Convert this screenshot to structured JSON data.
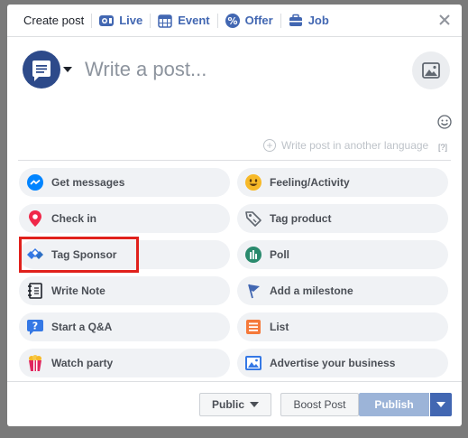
{
  "tabs": [
    {
      "label": "Create post",
      "icon": "pencil-icon"
    },
    {
      "label": "Live",
      "icon": "live-video-icon"
    },
    {
      "label": "Event",
      "icon": "calendar-icon"
    },
    {
      "label": "Offer",
      "icon": "percent-badge-icon"
    },
    {
      "label": "Job",
      "icon": "briefcase-icon"
    }
  ],
  "composer": {
    "placeholder": "Write a post...",
    "translate_label": "Write post in another language",
    "help_label": "[?]"
  },
  "options": [
    {
      "label": "Get messages",
      "icon": "messenger-icon",
      "color": "#0084ff"
    },
    {
      "label": "Feeling/Activity",
      "icon": "smiley-icon",
      "color": "#f7b928"
    },
    {
      "label": "Check in",
      "icon": "location-pin-icon",
      "color": "#f02849"
    },
    {
      "label": "Tag product",
      "icon": "tag-icon",
      "color": "#606770"
    },
    {
      "label": "Tag Sponsor",
      "icon": "handshake-icon",
      "color": "#3578e5"
    },
    {
      "label": "Poll",
      "icon": "poll-icon",
      "color": "#2a8a6d"
    },
    {
      "label": "Write Note",
      "icon": "notebook-icon",
      "color": "#1d2129"
    },
    {
      "label": "Add a milestone",
      "icon": "flag-icon",
      "color": "#4267b2"
    },
    {
      "label": "Start a Q&A",
      "icon": "question-bubble-icon",
      "color": "#3578e5"
    },
    {
      "label": "List",
      "icon": "list-icon",
      "color": "#f5793a"
    },
    {
      "label": "Watch party",
      "icon": "popcorn-icon",
      "color": "#e0245e"
    },
    {
      "label": "Advertise your business",
      "icon": "image-ad-icon",
      "color": "#3578e5"
    }
  ],
  "footer": {
    "audience_label": "Public",
    "boost_label": "Boost Post",
    "publish_label": "Publish"
  },
  "colors": {
    "accent": "#4267b2",
    "publish_disabled": "#9cb4d8",
    "highlight": "#e0211c"
  }
}
